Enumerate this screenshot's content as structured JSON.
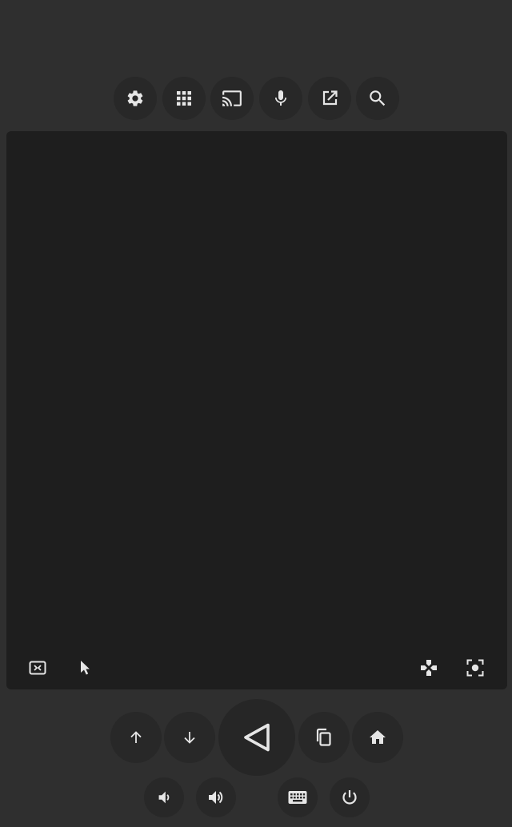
{
  "colors": {
    "background": "#2f2f2f",
    "button": "#282828",
    "touchpad": "#1e1e1e",
    "icon": "#e6e6e6"
  },
  "toolbar": {
    "icons": [
      "gear-icon",
      "apps-grid-icon",
      "cast-icon",
      "microphone-icon",
      "open-external-icon",
      "search-icon"
    ]
  },
  "touchpad": {
    "corner_icons": [
      "swap-mode-icon",
      "mouse-pointer-icon",
      "dpad-icon",
      "focus-capture-icon"
    ]
  },
  "navigation": {
    "icons": [
      "arrow-up-icon",
      "arrow-down-icon",
      "back-triangle-icon",
      "recent-apps-icon",
      "home-icon"
    ]
  },
  "system": {
    "icons": [
      "volume-down-icon",
      "volume-up-icon",
      "keyboard-icon",
      "power-icon"
    ]
  }
}
